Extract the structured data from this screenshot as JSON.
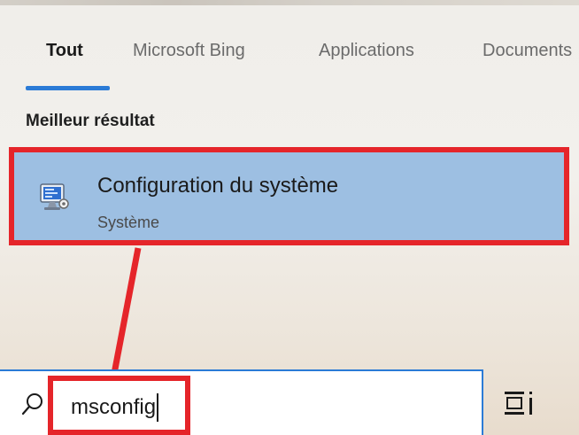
{
  "tabs": [
    {
      "label": "Tout",
      "active": true
    },
    {
      "label": "Microsoft Bing",
      "active": false
    },
    {
      "label": "Applications",
      "active": false
    },
    {
      "label": "Documents",
      "active": false
    }
  ],
  "section": {
    "title": "Meilleur résultat"
  },
  "best_result": {
    "title": "Configuration du système",
    "subtitle": "Système",
    "icon": "system-configuration-icon"
  },
  "search": {
    "query": "msconfig",
    "icon": "search-icon"
  },
  "taskbar": {
    "icon": "task-view-icon"
  },
  "colors": {
    "accent": "#2b7bd6",
    "highlight_border": "#e5252a",
    "selected_bg": "#9dbfe2"
  }
}
